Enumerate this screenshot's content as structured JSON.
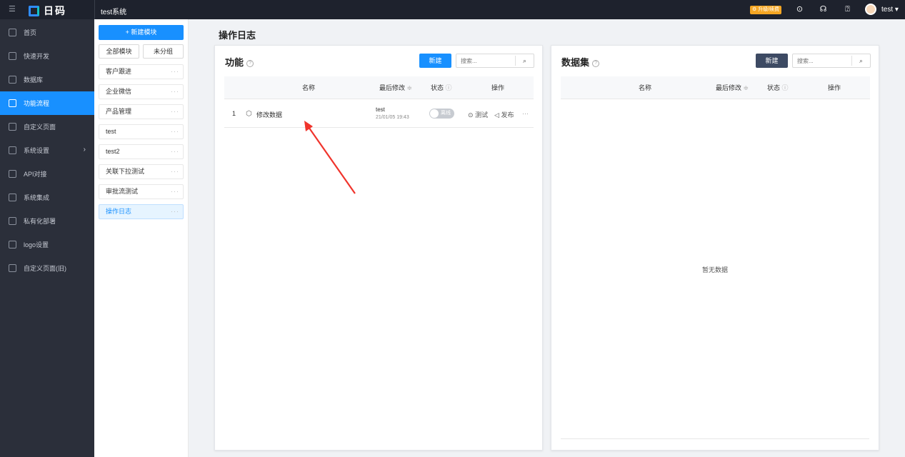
{
  "topbar": {
    "brand": "日码",
    "system_name": "test系统",
    "upgrade_label": "升级/续费",
    "user_name": "test ▾"
  },
  "sidebar": {
    "items": [
      {
        "label": "首页",
        "icon": "home-icon"
      },
      {
        "label": "快速开发",
        "icon": "cube-icon"
      },
      {
        "label": "数据库",
        "icon": "database-icon"
      },
      {
        "label": "功能流程",
        "icon": "flow-icon",
        "active": true
      },
      {
        "label": "自定义页面",
        "icon": "page-icon"
      },
      {
        "label": "系统设置",
        "icon": "monitor-icon",
        "expandable": true
      },
      {
        "label": "API对接",
        "icon": "api-icon"
      },
      {
        "label": "系统集成",
        "icon": "layers-icon"
      },
      {
        "label": "私有化部署",
        "icon": "server-icon"
      },
      {
        "label": "logo设置",
        "icon": "logo-icon"
      },
      {
        "label": "自定义页面(旧)",
        "icon": "page-old-icon"
      }
    ]
  },
  "modules": {
    "new_button": "+ 新建模块",
    "all_label": "全部模块",
    "ungrouped_label": "未分组",
    "items": [
      "客户跟进",
      "企业微信",
      "产品管理",
      "test",
      "test2",
      "关联下拉测试",
      "审批流测试",
      "操作日志"
    ],
    "active_index": 7,
    "more_glyph": "···"
  },
  "main": {
    "title": "操作日志",
    "functions": {
      "title": "功能",
      "new_button": "新建",
      "search_placeholder": "搜索...",
      "columns": {
        "name": "名称",
        "last_modified": "最后修改",
        "status": "状态",
        "actions": "操作"
      },
      "sort_glyph": "≑",
      "help_glyph": "?",
      "rows": [
        {
          "index": "1",
          "name": "修改数据",
          "editor": "test",
          "date": "21/01/05 19:43",
          "status": "离线",
          "test_label": "测试",
          "publish_label": "发布",
          "more": "···"
        }
      ]
    },
    "datasets": {
      "title": "数据集",
      "new_button": "新建",
      "search_placeholder": "搜索...",
      "columns": {
        "name": "名称",
        "last_modified": "最后修改",
        "status": "状态",
        "actions": "操作"
      },
      "empty_text": "暂无数据"
    }
  },
  "colors": {
    "primary": "#1890ff",
    "topbar_bg": "#1e222d",
    "sidebar_bg": "#2b2f3a",
    "dark_button": "#3d4a63",
    "upgrade": "#f5a623",
    "annotation_arrow": "#f0342c"
  }
}
